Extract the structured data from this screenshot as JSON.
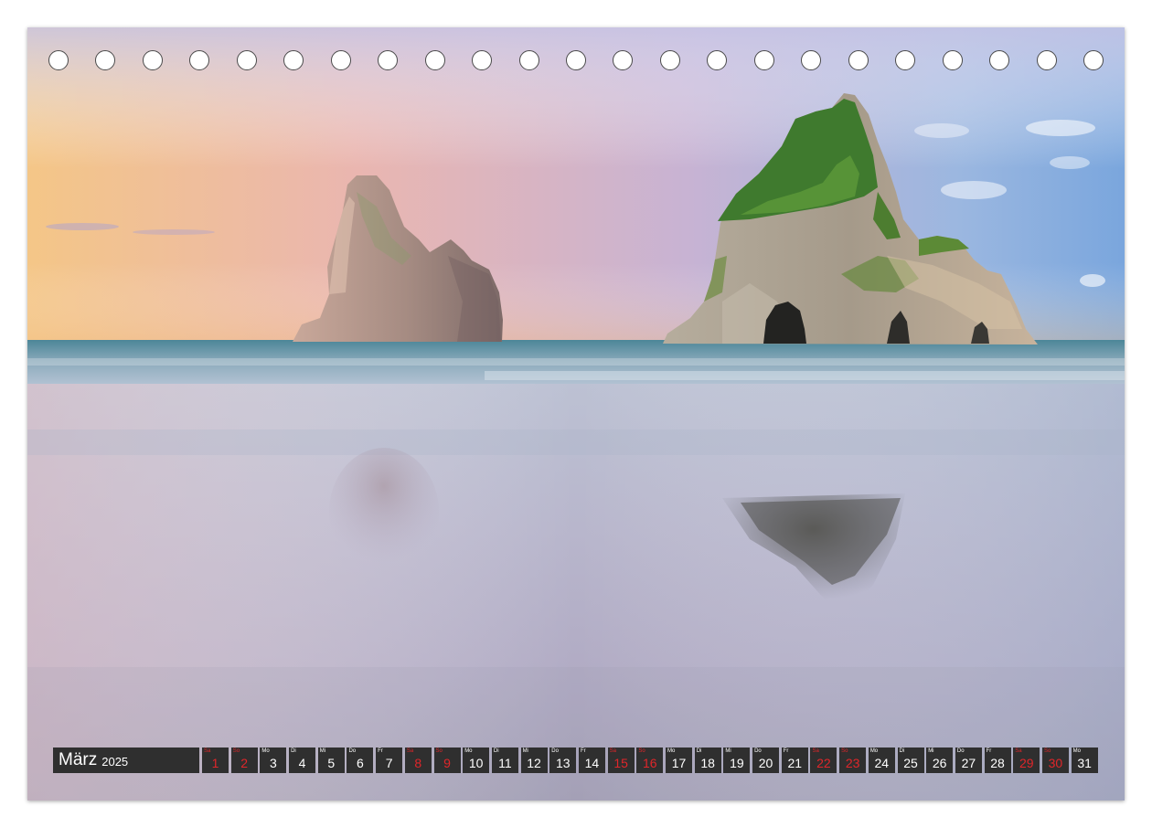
{
  "calendar": {
    "month": "März",
    "year": "2025",
    "days": [
      {
        "wd": "Sa",
        "num": "1",
        "weekend": true
      },
      {
        "wd": "So",
        "num": "2",
        "weekend": true
      },
      {
        "wd": "Mo",
        "num": "3",
        "weekend": false
      },
      {
        "wd": "Di",
        "num": "4",
        "weekend": false
      },
      {
        "wd": "Mi",
        "num": "5",
        "weekend": false
      },
      {
        "wd": "Do",
        "num": "6",
        "weekend": false
      },
      {
        "wd": "Fr",
        "num": "7",
        "weekend": false
      },
      {
        "wd": "Sa",
        "num": "8",
        "weekend": true
      },
      {
        "wd": "So",
        "num": "9",
        "weekend": true
      },
      {
        "wd": "Mo",
        "num": "10",
        "weekend": false
      },
      {
        "wd": "Di",
        "num": "11",
        "weekend": false
      },
      {
        "wd": "Mi",
        "num": "12",
        "weekend": false
      },
      {
        "wd": "Do",
        "num": "13",
        "weekend": false
      },
      {
        "wd": "Fr",
        "num": "14",
        "weekend": false
      },
      {
        "wd": "Sa",
        "num": "15",
        "weekend": true
      },
      {
        "wd": "So",
        "num": "16",
        "weekend": true
      },
      {
        "wd": "Mo",
        "num": "17",
        "weekend": false
      },
      {
        "wd": "Di",
        "num": "18",
        "weekend": false
      },
      {
        "wd": "Mi",
        "num": "19",
        "weekend": false
      },
      {
        "wd": "Do",
        "num": "20",
        "weekend": false
      },
      {
        "wd": "Fr",
        "num": "21",
        "weekend": false
      },
      {
        "wd": "Sa",
        "num": "22",
        "weekend": true
      },
      {
        "wd": "So",
        "num": "23",
        "weekend": true
      },
      {
        "wd": "Mo",
        "num": "24",
        "weekend": false
      },
      {
        "wd": "Di",
        "num": "25",
        "weekend": false
      },
      {
        "wd": "Mi",
        "num": "26",
        "weekend": false
      },
      {
        "wd": "Do",
        "num": "27",
        "weekend": false
      },
      {
        "wd": "Fr",
        "num": "28",
        "weekend": false
      },
      {
        "wd": "Sa",
        "num": "29",
        "weekend": true
      },
      {
        "wd": "So",
        "num": "30",
        "weekend": true
      },
      {
        "wd": "Mo",
        "num": "31",
        "weekend": false
      }
    ]
  },
  "binding": {
    "hole_count": 23
  },
  "colors": {
    "weekend": "#e0262a",
    "bar": "#2f2f2f",
    "text": "#ffffff"
  }
}
